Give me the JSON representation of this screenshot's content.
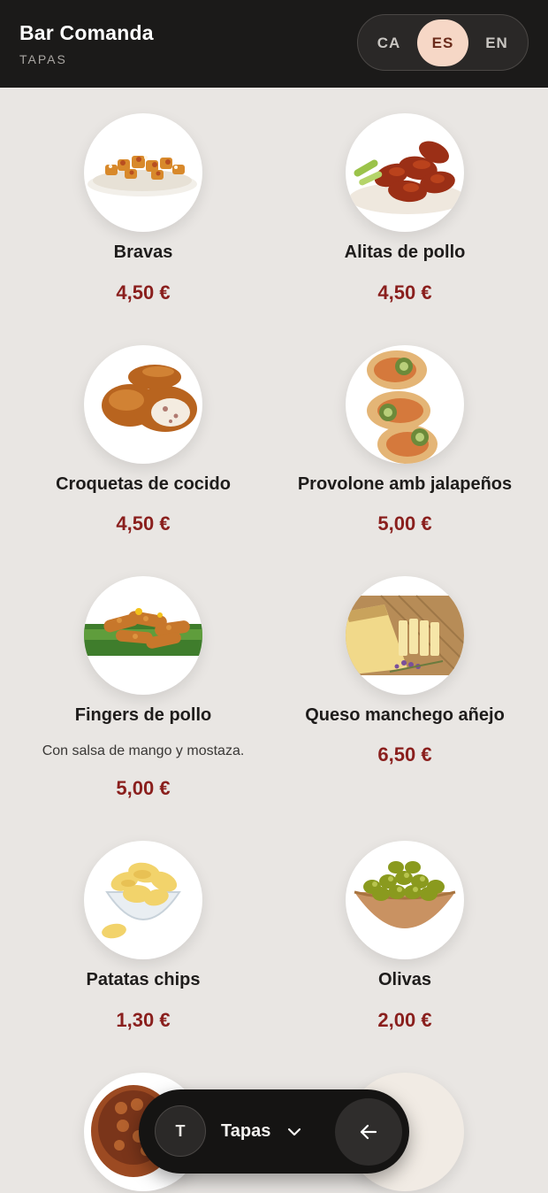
{
  "header": {
    "title": "Bar Comanda",
    "subtitle": "TAPAS",
    "languages": [
      "CA",
      "ES",
      "EN"
    ],
    "active_language": "ES"
  },
  "items": [
    {
      "name": "Bravas",
      "price": "4,50 €"
    },
    {
      "name": "Alitas de pollo",
      "price": "4,50 €"
    },
    {
      "name": "Croquetas de cocido",
      "price": "4,50 €"
    },
    {
      "name": "Provolone amb jalapeños",
      "price": "5,00 €"
    },
    {
      "name": "Fingers de pollo",
      "description": "Con salsa de mango y mostaza.",
      "price": "5,00 €"
    },
    {
      "name": "Queso manchego añejo",
      "price": "6,50 €"
    },
    {
      "name": "Patatas chips",
      "price": "1,30 €"
    },
    {
      "name": "Olivas",
      "price": "2,00 €"
    }
  ],
  "bottom_nav": {
    "badge": "T",
    "category": "Tapas",
    "chevron_icon": "chevron-down-icon",
    "back_icon": "arrow-left-icon"
  },
  "colors": {
    "header_bg": "#1b1a19",
    "page_bg": "#e9e6e3",
    "price": "#8a1f1d",
    "active_lang_bg": "#f6d7c6"
  }
}
